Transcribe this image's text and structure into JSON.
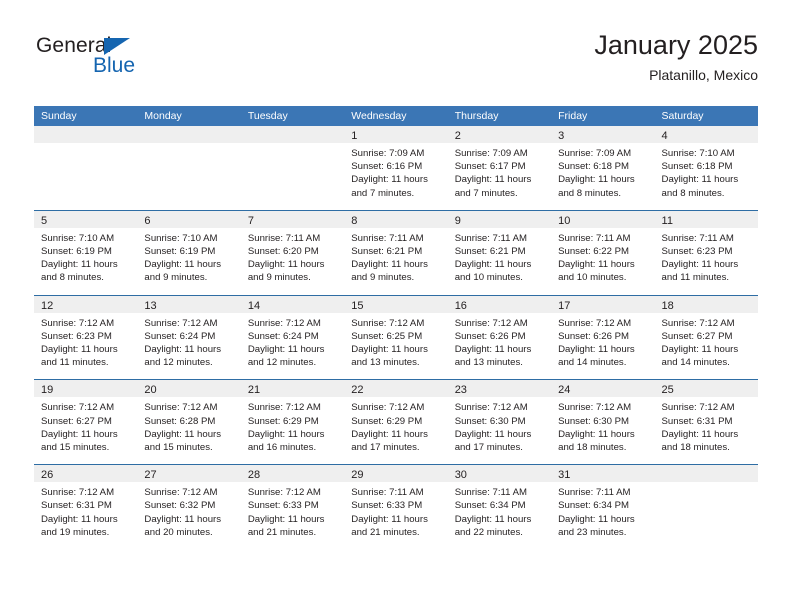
{
  "brand": {
    "name_top": "General",
    "name_bottom": "Blue",
    "triangle_color": "#1565b0",
    "text_color": "#231f20"
  },
  "header": {
    "title": "January 2025",
    "subtitle": "Platanillo, Mexico"
  },
  "theme": {
    "header_band": "#3b76b5",
    "row_divider": "#2e6da4",
    "daynum_band": "#efefef",
    "page_background": "#ffffff",
    "text": "#231f20"
  },
  "weekdays": [
    "Sunday",
    "Monday",
    "Tuesday",
    "Wednesday",
    "Thursday",
    "Friday",
    "Saturday"
  ],
  "labels": {
    "sunrise_prefix": "Sunrise:",
    "sunset_prefix": "Sunset:",
    "daylight_prefix": "Daylight:"
  },
  "weeks": [
    [
      {
        "day": "",
        "empty": true,
        "sunrise": "",
        "sunset": "",
        "daylight": ""
      },
      {
        "day": "",
        "empty": true,
        "sunrise": "",
        "sunset": "",
        "daylight": ""
      },
      {
        "day": "",
        "empty": true,
        "sunrise": "",
        "sunset": "",
        "daylight": ""
      },
      {
        "day": "1",
        "empty": false,
        "sunrise": "Sunrise: 7:09 AM",
        "sunset": "Sunset: 6:16 PM",
        "daylight": "Daylight: 11 hours and 7 minutes."
      },
      {
        "day": "2",
        "empty": false,
        "sunrise": "Sunrise: 7:09 AM",
        "sunset": "Sunset: 6:17 PM",
        "daylight": "Daylight: 11 hours and 7 minutes."
      },
      {
        "day": "3",
        "empty": false,
        "sunrise": "Sunrise: 7:09 AM",
        "sunset": "Sunset: 6:18 PM",
        "daylight": "Daylight: 11 hours and 8 minutes."
      },
      {
        "day": "4",
        "empty": false,
        "sunrise": "Sunrise: 7:10 AM",
        "sunset": "Sunset: 6:18 PM",
        "daylight": "Daylight: 11 hours and 8 minutes."
      }
    ],
    [
      {
        "day": "5",
        "empty": false,
        "sunrise": "Sunrise: 7:10 AM",
        "sunset": "Sunset: 6:19 PM",
        "daylight": "Daylight: 11 hours and 8 minutes."
      },
      {
        "day": "6",
        "empty": false,
        "sunrise": "Sunrise: 7:10 AM",
        "sunset": "Sunset: 6:19 PM",
        "daylight": "Daylight: 11 hours and 9 minutes."
      },
      {
        "day": "7",
        "empty": false,
        "sunrise": "Sunrise: 7:11 AM",
        "sunset": "Sunset: 6:20 PM",
        "daylight": "Daylight: 11 hours and 9 minutes."
      },
      {
        "day": "8",
        "empty": false,
        "sunrise": "Sunrise: 7:11 AM",
        "sunset": "Sunset: 6:21 PM",
        "daylight": "Daylight: 11 hours and 9 minutes."
      },
      {
        "day": "9",
        "empty": false,
        "sunrise": "Sunrise: 7:11 AM",
        "sunset": "Sunset: 6:21 PM",
        "daylight": "Daylight: 11 hours and 10 minutes."
      },
      {
        "day": "10",
        "empty": false,
        "sunrise": "Sunrise: 7:11 AM",
        "sunset": "Sunset: 6:22 PM",
        "daylight": "Daylight: 11 hours and 10 minutes."
      },
      {
        "day": "11",
        "empty": false,
        "sunrise": "Sunrise: 7:11 AM",
        "sunset": "Sunset: 6:23 PM",
        "daylight": "Daylight: 11 hours and 11 minutes."
      }
    ],
    [
      {
        "day": "12",
        "empty": false,
        "sunrise": "Sunrise: 7:12 AM",
        "sunset": "Sunset: 6:23 PM",
        "daylight": "Daylight: 11 hours and 11 minutes."
      },
      {
        "day": "13",
        "empty": false,
        "sunrise": "Sunrise: 7:12 AM",
        "sunset": "Sunset: 6:24 PM",
        "daylight": "Daylight: 11 hours and 12 minutes."
      },
      {
        "day": "14",
        "empty": false,
        "sunrise": "Sunrise: 7:12 AM",
        "sunset": "Sunset: 6:24 PM",
        "daylight": "Daylight: 11 hours and 12 minutes."
      },
      {
        "day": "15",
        "empty": false,
        "sunrise": "Sunrise: 7:12 AM",
        "sunset": "Sunset: 6:25 PM",
        "daylight": "Daylight: 11 hours and 13 minutes."
      },
      {
        "day": "16",
        "empty": false,
        "sunrise": "Sunrise: 7:12 AM",
        "sunset": "Sunset: 6:26 PM",
        "daylight": "Daylight: 11 hours and 13 minutes."
      },
      {
        "day": "17",
        "empty": false,
        "sunrise": "Sunrise: 7:12 AM",
        "sunset": "Sunset: 6:26 PM",
        "daylight": "Daylight: 11 hours and 14 minutes."
      },
      {
        "day": "18",
        "empty": false,
        "sunrise": "Sunrise: 7:12 AM",
        "sunset": "Sunset: 6:27 PM",
        "daylight": "Daylight: 11 hours and 14 minutes."
      }
    ],
    [
      {
        "day": "19",
        "empty": false,
        "sunrise": "Sunrise: 7:12 AM",
        "sunset": "Sunset: 6:27 PM",
        "daylight": "Daylight: 11 hours and 15 minutes."
      },
      {
        "day": "20",
        "empty": false,
        "sunrise": "Sunrise: 7:12 AM",
        "sunset": "Sunset: 6:28 PM",
        "daylight": "Daylight: 11 hours and 15 minutes."
      },
      {
        "day": "21",
        "empty": false,
        "sunrise": "Sunrise: 7:12 AM",
        "sunset": "Sunset: 6:29 PM",
        "daylight": "Daylight: 11 hours and 16 minutes."
      },
      {
        "day": "22",
        "empty": false,
        "sunrise": "Sunrise: 7:12 AM",
        "sunset": "Sunset: 6:29 PM",
        "daylight": "Daylight: 11 hours and 17 minutes."
      },
      {
        "day": "23",
        "empty": false,
        "sunrise": "Sunrise: 7:12 AM",
        "sunset": "Sunset: 6:30 PM",
        "daylight": "Daylight: 11 hours and 17 minutes."
      },
      {
        "day": "24",
        "empty": false,
        "sunrise": "Sunrise: 7:12 AM",
        "sunset": "Sunset: 6:30 PM",
        "daylight": "Daylight: 11 hours and 18 minutes."
      },
      {
        "day": "25",
        "empty": false,
        "sunrise": "Sunrise: 7:12 AM",
        "sunset": "Sunset: 6:31 PM",
        "daylight": "Daylight: 11 hours and 18 minutes."
      }
    ],
    [
      {
        "day": "26",
        "empty": false,
        "sunrise": "Sunrise: 7:12 AM",
        "sunset": "Sunset: 6:31 PM",
        "daylight": "Daylight: 11 hours and 19 minutes."
      },
      {
        "day": "27",
        "empty": false,
        "sunrise": "Sunrise: 7:12 AM",
        "sunset": "Sunset: 6:32 PM",
        "daylight": "Daylight: 11 hours and 20 minutes."
      },
      {
        "day": "28",
        "empty": false,
        "sunrise": "Sunrise: 7:12 AM",
        "sunset": "Sunset: 6:33 PM",
        "daylight": "Daylight: 11 hours and 21 minutes."
      },
      {
        "day": "29",
        "empty": false,
        "sunrise": "Sunrise: 7:11 AM",
        "sunset": "Sunset: 6:33 PM",
        "daylight": "Daylight: 11 hours and 21 minutes."
      },
      {
        "day": "30",
        "empty": false,
        "sunrise": "Sunrise: 7:11 AM",
        "sunset": "Sunset: 6:34 PM",
        "daylight": "Daylight: 11 hours and 22 minutes."
      },
      {
        "day": "31",
        "empty": false,
        "sunrise": "Sunrise: 7:11 AM",
        "sunset": "Sunset: 6:34 PM",
        "daylight": "Daylight: 11 hours and 23 minutes."
      },
      {
        "day": "",
        "empty": true,
        "sunrise": "",
        "sunset": "",
        "daylight": ""
      }
    ]
  ]
}
